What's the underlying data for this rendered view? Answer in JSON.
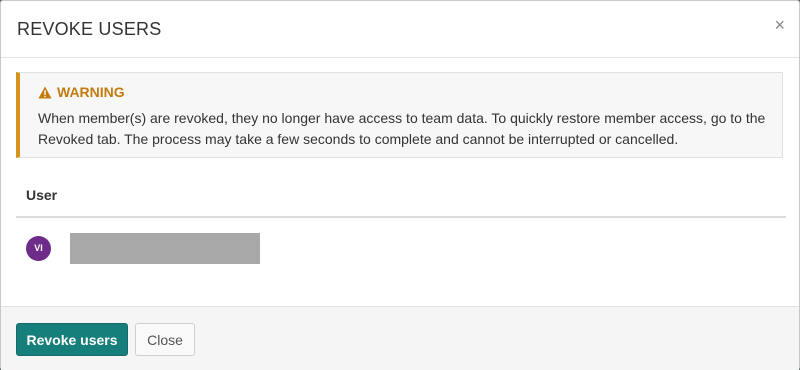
{
  "modal": {
    "title": "REVOKE USERS",
    "close_glyph": "×"
  },
  "warning": {
    "icon": "warning-triangle-icon",
    "title": "WARNING",
    "text": "When member(s) are revoked, they no longer have access to team data. To quickly restore member access, go to the Revoked tab. The process may take a few seconds to complete and cannot be interrupted or cancelled.",
    "accent_color": "#d4941d",
    "title_color": "#c27c0e"
  },
  "table": {
    "column_header": "User",
    "rows": [
      {
        "avatar_initials": "VI",
        "avatar_color": "#6f2b8a",
        "name_redacted": true
      }
    ]
  },
  "footer": {
    "primary_label": "Revoke users",
    "secondary_label": "Close",
    "primary_color": "#177f7b"
  }
}
